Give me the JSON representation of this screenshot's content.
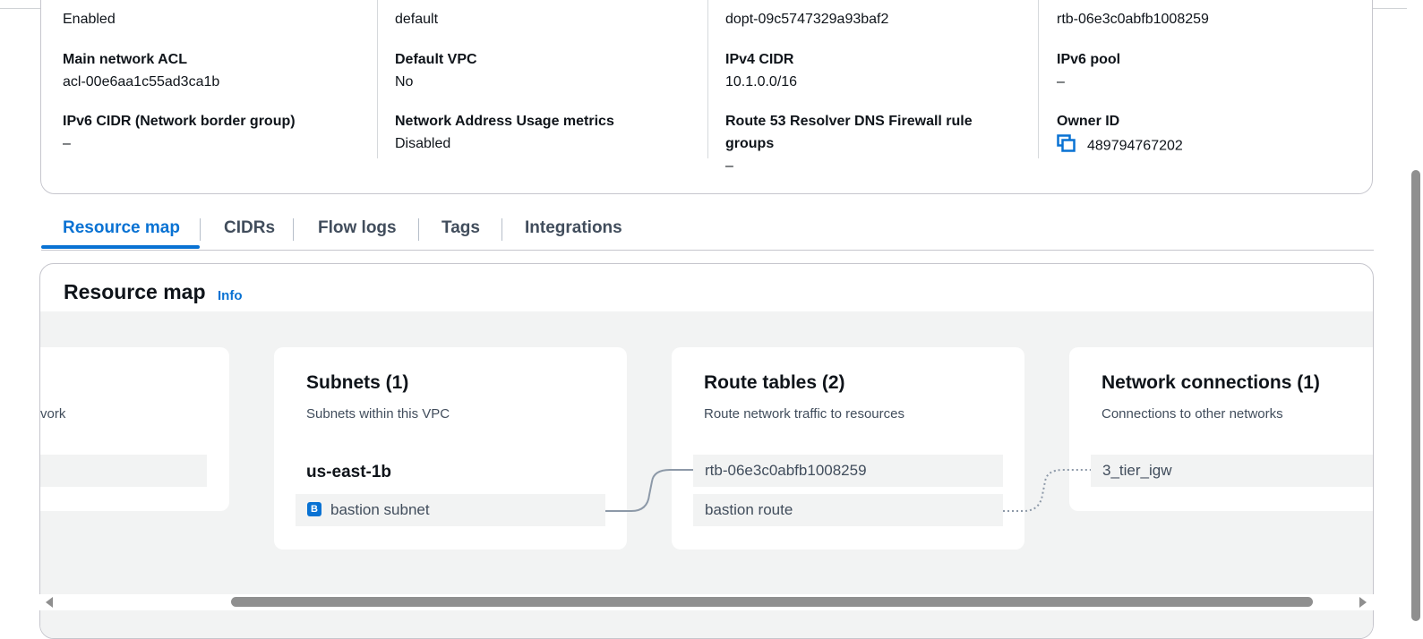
{
  "details": {
    "col1": {
      "row0_value": "Enabled",
      "row1_key": "Main network ACL",
      "row1_value": "acl-00e6aa1c55ad3ca1b",
      "row2_key": "IPv6 CIDR (Network border group)",
      "row2_value": "–"
    },
    "col2": {
      "row0_value": "default",
      "row1_key": "Default VPC",
      "row1_value": "No",
      "row2_key": "Network Address Usage metrics",
      "row2_value": "Disabled"
    },
    "col3": {
      "row0_value": "dopt-09c5747329a93baf2",
      "row1_key": "IPv4 CIDR",
      "row1_value": "10.1.0.0/16",
      "row2_key_line1": "Route 53 Resolver DNS Firewall rule",
      "row2_key_line2": "groups",
      "row2_value": "–"
    },
    "col4": {
      "row0_value": "rtb-06e3c0abfb1008259",
      "row1_key": "IPv6 pool",
      "row1_value": "–",
      "row2_key": "Owner ID",
      "row2_value": "489794767202"
    }
  },
  "tabs": [
    {
      "label": "Resource map",
      "active": true
    },
    {
      "label": "CIDRs"
    },
    {
      "label": "Flow logs"
    },
    {
      "label": "Tags"
    },
    {
      "label": "Integrations"
    }
  ],
  "resource_map": {
    "title": "Resource map",
    "info_label": "Info",
    "vpc_card": {
      "subtitle_fragment": "vork"
    },
    "subnets": {
      "title": "Subnets (1)",
      "subtitle": "Subnets within this VPC",
      "az": "us-east-1b",
      "badge": "B",
      "items": [
        "bastion subnet"
      ]
    },
    "route_tables": {
      "title": "Route tables (2)",
      "subtitle": "Route network traffic to resources",
      "items": [
        "rtb-06e3c0abfb1008259",
        "bastion route"
      ]
    },
    "network_connections": {
      "title": "Network connections (1)",
      "subtitle": "Connections to other networks",
      "items": [
        "3_tier_igw"
      ]
    }
  },
  "colors": {
    "link": "#0972d3",
    "border": "#c6c6cd",
    "canvas_bg": "#f2f3f3",
    "connector": "#8d99a8"
  },
  "icons": [
    "copy-icon",
    "subnet-badge-icon",
    "scroll-left-arrow-icon",
    "scroll-right-arrow-icon"
  ]
}
